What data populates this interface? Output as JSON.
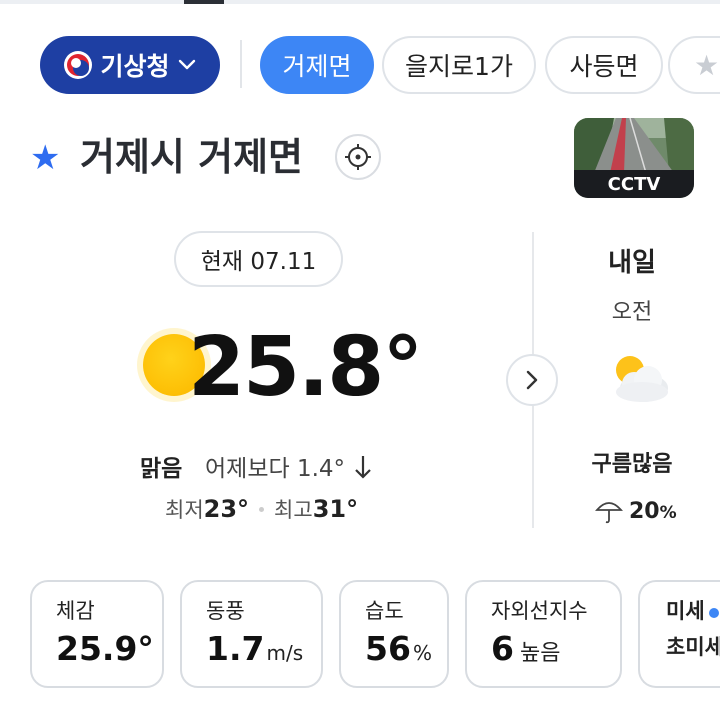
{
  "filters": {
    "agency": "기상청",
    "chips": [
      "거제면",
      "을지로1가",
      "사등면"
    ],
    "active": "거제면"
  },
  "location": {
    "title": "거제시 거제면"
  },
  "cctv": {
    "label": "CCTV"
  },
  "current": {
    "date": "현재 07.11",
    "temperature": "25.8°",
    "condition": "맑음",
    "compare": "어제보다 1.4°",
    "low_label": "최저",
    "low": "23°",
    "high_label": "최고",
    "high": "31°"
  },
  "tomorrow": {
    "title": "내일",
    "period": "오전",
    "condition": "구름많음",
    "rain_chance": "20",
    "rain_unit": "%"
  },
  "details": [
    {
      "label": "체감",
      "value": "25.9°",
      "unit": ""
    },
    {
      "label": "동풍",
      "value": "1.7",
      "unit": "m/s"
    },
    {
      "label": "습도",
      "value": "56",
      "unit": "%"
    },
    {
      "label": "자외선지수",
      "value": "6",
      "unit": "높음"
    },
    {
      "label": "미세",
      "value": "초미세"
    }
  ],
  "colors": {
    "agency_chip": "#1e3fa3",
    "active_chip": "#3d86f5",
    "star": "#2e6cf0",
    "sun": "#fdbf05"
  }
}
